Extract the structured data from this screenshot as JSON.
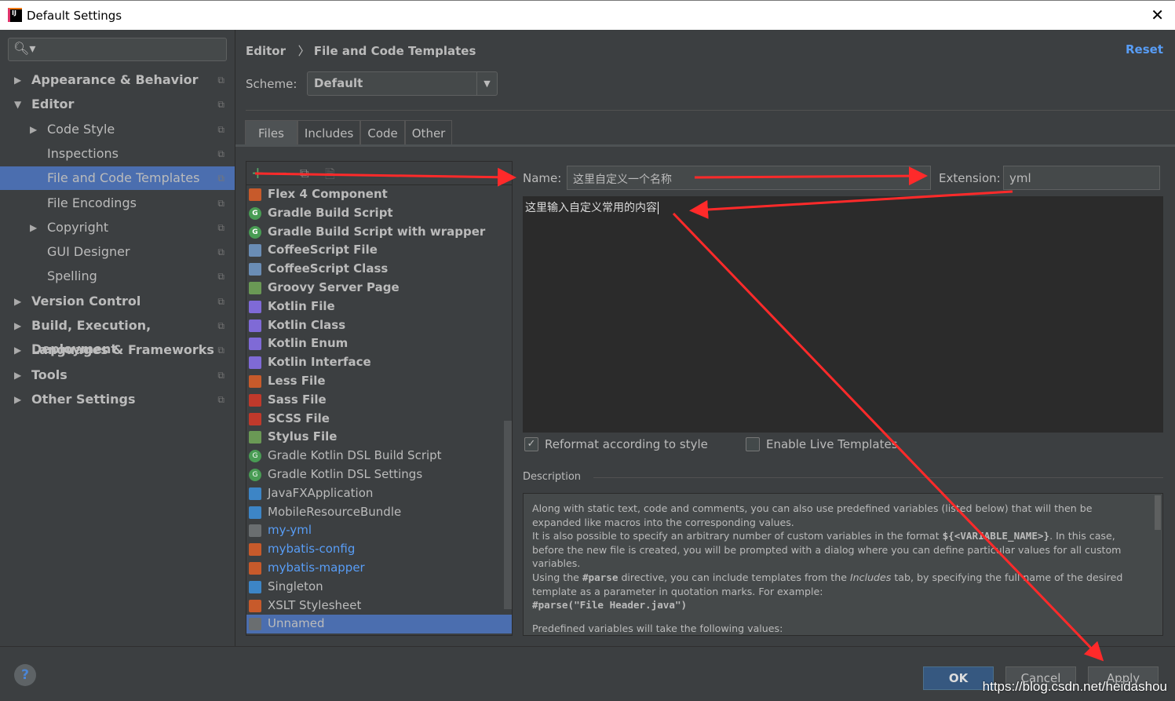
{
  "window": {
    "title": "Default Settings"
  },
  "sidebar": {
    "items": [
      {
        "label": "Appearance & Behavior",
        "level": 0,
        "arrow": "right",
        "bold": true
      },
      {
        "label": "Editor",
        "level": 0,
        "arrow": "down",
        "bold": true
      },
      {
        "label": "Code Style",
        "level": 1,
        "arrow": "right"
      },
      {
        "label": "Inspections",
        "level": 1
      },
      {
        "label": "File and Code Templates",
        "level": 1,
        "selected": true
      },
      {
        "label": "File Encodings",
        "level": 1
      },
      {
        "label": "Copyright",
        "level": 1,
        "arrow": "right"
      },
      {
        "label": "GUI Designer",
        "level": 1
      },
      {
        "label": "Spelling",
        "level": 1
      },
      {
        "label": "Version Control",
        "level": 0,
        "arrow": "right",
        "bold": true
      },
      {
        "label": "Build, Execution, Deployment",
        "level": 0,
        "arrow": "right",
        "bold": true
      },
      {
        "label": "Languages & Frameworks",
        "level": 0,
        "arrow": "right",
        "bold": true
      },
      {
        "label": "Tools",
        "level": 0,
        "arrow": "right",
        "bold": true
      },
      {
        "label": "Other Settings",
        "level": 0,
        "arrow": "right",
        "bold": true
      }
    ]
  },
  "header": {
    "breadcrumb_parent": "Editor",
    "breadcrumb_sep": "〉",
    "breadcrumb_current": "File and Code Templates",
    "reset": "Reset"
  },
  "scheme": {
    "label": "Scheme:",
    "value": "Default"
  },
  "tabs": [
    "Files",
    "Includes",
    "Code",
    "Other"
  ],
  "templates": [
    {
      "label": "Flex 4 Component",
      "bold": true,
      "icon": "#c75a2b"
    },
    {
      "label": "Gradle Build Script",
      "bold": true,
      "icon": "#499c54",
      "round": true
    },
    {
      "label": "Gradle Build Script with wrapper",
      "bold": true,
      "icon": "#499c54",
      "round": true
    },
    {
      "label": "CoffeeScript File",
      "bold": true,
      "icon": "#6a8db5"
    },
    {
      "label": "CoffeeScript Class",
      "bold": true,
      "icon": "#6a8db5"
    },
    {
      "label": "Groovy Server Page",
      "bold": true,
      "icon": "#6a9955"
    },
    {
      "label": "Kotlin File",
      "bold": true,
      "icon": "#7f6ad6"
    },
    {
      "label": "Kotlin Class",
      "bold": true,
      "icon": "#7f6ad6"
    },
    {
      "label": "Kotlin Enum",
      "bold": true,
      "icon": "#7f6ad6"
    },
    {
      "label": "Kotlin Interface",
      "bold": true,
      "icon": "#7f6ad6"
    },
    {
      "label": "Less File",
      "bold": true,
      "icon": "#c75a2b"
    },
    {
      "label": "Sass File",
      "bold": true,
      "icon": "#c0392b"
    },
    {
      "label": "SCSS File",
      "bold": true,
      "icon": "#c0392b"
    },
    {
      "label": "Stylus File",
      "bold": true,
      "icon": "#6a9955"
    },
    {
      "label": "Gradle Kotlin DSL Build Script",
      "icon": "#499c54",
      "round": true
    },
    {
      "label": "Gradle Kotlin DSL Settings",
      "icon": "#499c54",
      "round": true
    },
    {
      "label": "JavaFXApplication",
      "icon": "#3d85c6"
    },
    {
      "label": "MobileResourceBundle",
      "icon": "#3d85c6"
    },
    {
      "label": "my-yml",
      "blue": true,
      "icon": "#6a6e70"
    },
    {
      "label": "mybatis-config",
      "blue": true,
      "icon": "#c75a2b"
    },
    {
      "label": "mybatis-mapper",
      "blue": true,
      "icon": "#c75a2b"
    },
    {
      "label": "Singleton",
      "icon": "#3d85c6"
    },
    {
      "label": "XSLT Stylesheet",
      "icon": "#c75a2b"
    },
    {
      "label": "Unnamed",
      "selected": true,
      "icon": "#6a6e70"
    }
  ],
  "form": {
    "name_label": "Name:",
    "name_value": "这里自定义一个名称",
    "ext_label": "Extension:",
    "ext_value": "yml",
    "content": "这里输入自定义常用的内容",
    "reformat": "Reformat according to style",
    "reformat_checked": true,
    "live": "Enable Live Templates",
    "live_checked": false
  },
  "description": {
    "label": "Description",
    "p1": "Along with static text, code and comments, you can also use predefined variables (listed below) that will then be expanded like macros into the corresponding values.",
    "p2a": "It is also possible to specify an arbitrary number of custom variables in the format ",
    "p2code": "${<VARIABLE_NAME>}",
    "p2b": ". In this case, before the new file is created, you will be prompted with a dialog where you can define particular values for all custom variables.",
    "p3a": "Using the ",
    "p3code": "#parse",
    "p3b": " directive, you can include templates from the ",
    "p3i": "Includes",
    "p3c": " tab, by specifying the full name of the desired template as a parameter in quotation marks. For example:",
    "p4": "#parse(\"File Header.java\")",
    "p5": "Predefined variables will take the following values:"
  },
  "footer": {
    "help": "?",
    "ok": "OK",
    "cancel": "Cancel",
    "apply": "Apply",
    "watermark": "https://blog.csdn.net/heidashou"
  },
  "colors": {
    "accent": "#4b6eaf",
    "link": "#589df6",
    "annotation": "#ff2a2a"
  }
}
